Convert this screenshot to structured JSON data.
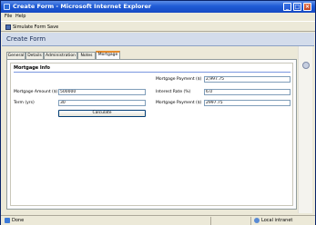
{
  "window": {
    "title": "Create Form - Microsoft Internet Explorer",
    "minimize": "_",
    "maximize": "□",
    "close": "×"
  },
  "menu": {
    "file": "File",
    "help": "Help"
  },
  "toolbar": {
    "simulate_label": "Simulate Form Save",
    "simulate_icon": "disk-icon"
  },
  "form": {
    "header": "Create Form",
    "tabs": [
      {
        "label": "General"
      },
      {
        "label": "Details"
      },
      {
        "label": "Administration"
      },
      {
        "label": "Notes"
      },
      {
        "label": "Mortgage",
        "active": true
      }
    ],
    "section_title": "Mortgage Info",
    "fields": {
      "mortgage_payment_top": {
        "label": "Mortgage Payment ($)",
        "value": "2,997.75"
      },
      "mortgage_amount": {
        "label": "Mortgage Amount ($)",
        "value": "500000"
      },
      "interest_rate": {
        "label": "Interest Rate (%)",
        "value": "6.0"
      },
      "term": {
        "label": "Term (yrs)",
        "value": "30"
      },
      "mortgage_payment_bottom": {
        "label": "Mortgage Payment ($)",
        "value": "2997.75"
      }
    },
    "calculate_label": "Calculate"
  },
  "status": {
    "text": "Done",
    "zone": "Local intranet"
  }
}
